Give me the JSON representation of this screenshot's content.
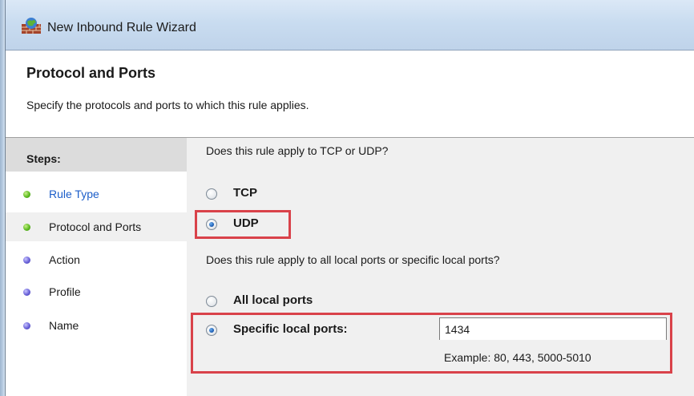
{
  "window": {
    "title": "New Inbound Rule Wizard",
    "icon": "firewall-icon"
  },
  "header": {
    "title": "Protocol and Ports",
    "description": "Specify the protocols and ports to which this rule applies."
  },
  "steps": {
    "heading": "Steps:",
    "items": [
      {
        "label": "Rule Type",
        "status": "done",
        "link": true
      },
      {
        "label": "Protocol and Ports",
        "status": "done",
        "current": true
      },
      {
        "label": "Action",
        "status": "pending"
      },
      {
        "label": "Profile",
        "status": "pending"
      },
      {
        "label": "Name",
        "status": "pending"
      }
    ]
  },
  "protocol": {
    "question": "Does this rule apply to TCP or UDP?",
    "options": [
      {
        "label": "TCP",
        "selected": false
      },
      {
        "label": "UDP",
        "selected": true
      }
    ]
  },
  "ports": {
    "question": "Does this rule apply to all local ports or specific local ports?",
    "options": [
      {
        "label": "All local ports",
        "selected": false
      },
      {
        "label": "Specific local ports:",
        "selected": true
      }
    ],
    "value": "1434",
    "example": "Example: 80, 443, 5000-5010"
  },
  "colors": {
    "highlight": "#d9424a",
    "link": "#1c5ec9",
    "step_done": "#5dbb21",
    "step_pending": "#6a62d8"
  }
}
